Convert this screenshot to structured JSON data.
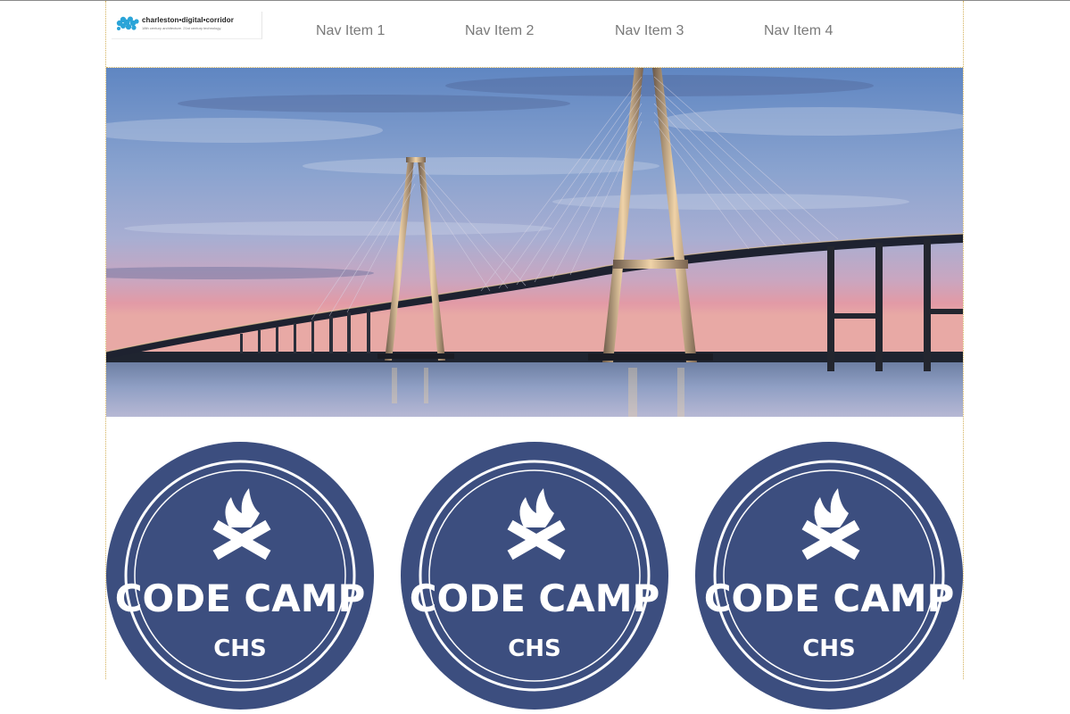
{
  "brand": {
    "name": "charleston•digital•corridor",
    "tagline": "18th century architecture. 21st century technology"
  },
  "nav": {
    "items": [
      {
        "label": "Nav Item 1"
      },
      {
        "label": "Nav Item 2"
      },
      {
        "label": "Nav Item 3"
      },
      {
        "label": "Nav Item 4"
      }
    ]
  },
  "hero": {
    "icon": "bridge-photo"
  },
  "badges": [
    {
      "title": "CODE CAMP",
      "subtitle": "CHS"
    },
    {
      "title": "CODE CAMP",
      "subtitle": "CHS"
    },
    {
      "title": "CODE CAMP",
      "subtitle": "CHS"
    }
  ],
  "colors": {
    "badge": "#3c4e7f",
    "nav_text": "#7a7a7a",
    "logo_blue": "#2aa4d8",
    "container_border": "#d4b25c"
  }
}
